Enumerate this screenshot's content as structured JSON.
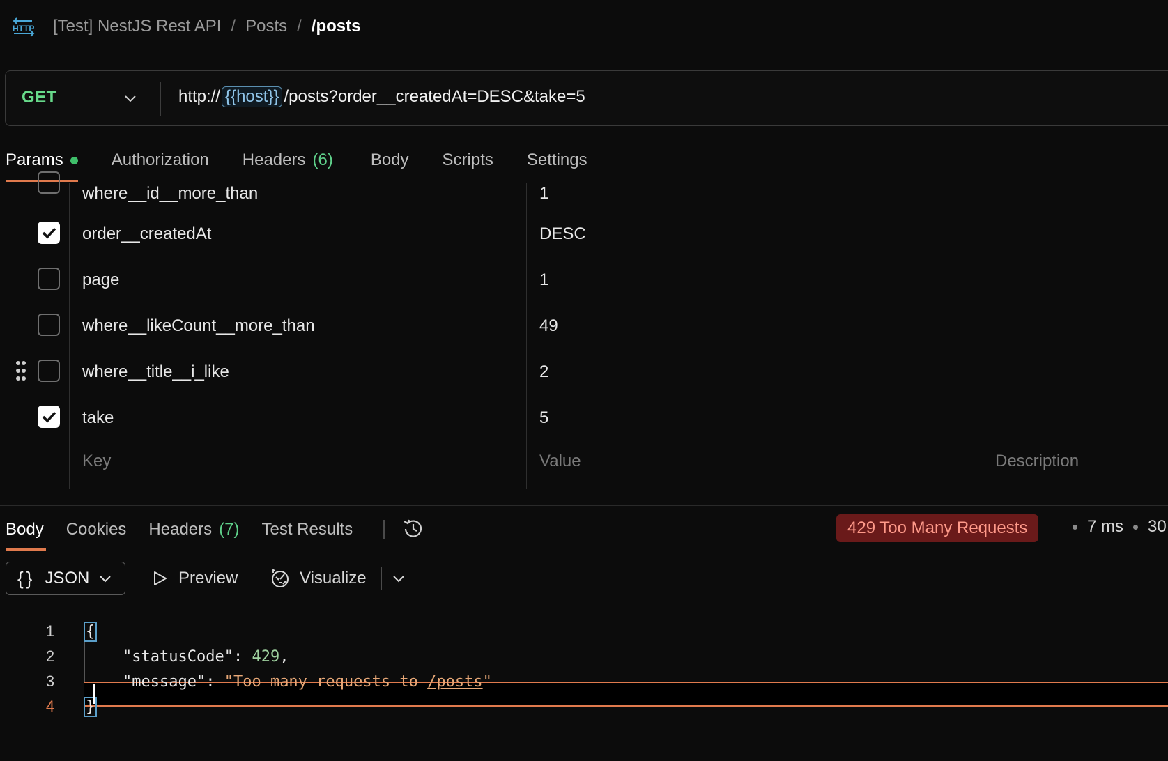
{
  "header": {
    "icon": "http-icon",
    "breadcrumb": [
      "[Test] NestJS Rest API",
      "Posts",
      "/posts"
    ],
    "separator": "/"
  },
  "request": {
    "method": "GET",
    "url_prefix": "http://",
    "url_variable": "{{host}}",
    "url_suffix": "/posts?order__createdAt=DESC&take=5"
  },
  "request_tabs": [
    {
      "label": "Params",
      "active": true,
      "dot": true
    },
    {
      "label": "Authorization"
    },
    {
      "label": "Headers",
      "count": "(6)"
    },
    {
      "label": "Body"
    },
    {
      "label": "Scripts"
    },
    {
      "label": "Settings"
    }
  ],
  "params": {
    "rows": [
      {
        "key": "where__id__more_than",
        "value": "1",
        "checked": false
      },
      {
        "key": "order__createdAt",
        "value": "DESC",
        "checked": true
      },
      {
        "key": "page",
        "value": "1",
        "checked": false
      },
      {
        "key": "where__likeCount__more_than",
        "value": "49",
        "checked": false
      },
      {
        "key": "where__title__i_like",
        "value": "2",
        "checked": false
      },
      {
        "key": "take",
        "value": "5",
        "checked": true
      }
    ],
    "placeholders": {
      "key": "Key",
      "value": "Value",
      "description": "Description"
    }
  },
  "response": {
    "tabs": [
      {
        "label": "Body",
        "active": true
      },
      {
        "label": "Cookies"
      },
      {
        "label": "Headers",
        "count": "(7)"
      },
      {
        "label": "Test Results"
      }
    ],
    "status": "429 Too Many Requests",
    "time": "7 ms",
    "size": "30",
    "format": "JSON",
    "preview_label": "Preview",
    "visualize_label": "Visualize",
    "code_lines": [
      "1",
      "2",
      "3",
      "4"
    ],
    "body": {
      "open_brace": "{",
      "key1": "\"statusCode\"",
      "val1": "429",
      "key2": "\"message\"",
      "val2_prefix": "\"Too many requests to ",
      "val2_link": "/posts",
      "val2_suffix": "\"",
      "close_brace": "}"
    }
  },
  "colors": {
    "method": "#67d98a",
    "accent": "#e07a4d",
    "status_bg": "#6a1a1a",
    "status_text": "#ff9a8a",
    "count": "#5fd08a"
  }
}
